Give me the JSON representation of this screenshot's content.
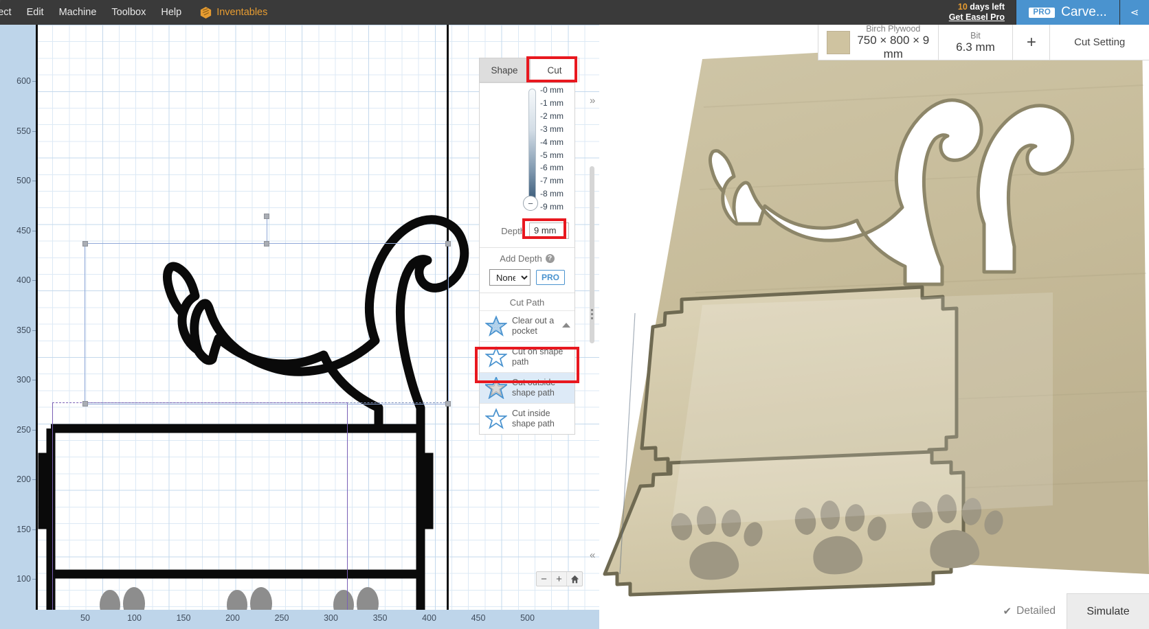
{
  "menubar": {
    "items": [
      "ject",
      "Edit",
      "Machine",
      "Toolbox",
      "Help"
    ],
    "brand": "Inventables",
    "trial_days": "10",
    "trial_text": " days left",
    "trial_link": "Get Easel Pro",
    "pro_chip": "PRO",
    "carve_label": "Carve...",
    "share_glyph": "⋖"
  },
  "canvas": {
    "y_ticks": [
      "600",
      "550",
      "500",
      "450",
      "400",
      "350",
      "300",
      "250",
      "200",
      "150",
      "100"
    ],
    "x_ticks": [
      "50",
      "100",
      "150",
      "200",
      "250",
      "300",
      "350",
      "400",
      "450",
      "500"
    ],
    "zoom_out": "−",
    "zoom_in": "+",
    "home": "home-icon"
  },
  "cut_panel": {
    "tab_shape": "Shape",
    "tab_cut": "Cut",
    "slider_labels": [
      "-0 mm",
      "-1 mm",
      "-2 mm",
      "-3 mm",
      "-4 mm",
      "-5 mm",
      "-6 mm",
      "-7 mm",
      "-8 mm",
      "-9 mm"
    ],
    "knob_glyph": "−",
    "depth_label": "Depth",
    "depth_value": "9 mm",
    "add_depth_label": "Add Depth",
    "help_glyph": "?",
    "add_depth_value": "None",
    "add_depth_options": [
      "None"
    ],
    "pro_badge": "PRO",
    "cut_path_title": "Cut Path",
    "cut_path_options": [
      {
        "label": "Clear out a pocket",
        "icon": "star-filled-icon",
        "selected": false
      },
      {
        "label": "Cut on shape path",
        "icon": "star-outline-icon",
        "selected": false
      },
      {
        "label": "Cut outside shape path",
        "icon": "star-outside-icon",
        "selected": true
      },
      {
        "label": "Cut inside shape path",
        "icon": "star-inside-icon",
        "selected": false
      }
    ]
  },
  "preview": {
    "material_name": "Birch Plywood",
    "material_size": "750 × 800 × 9 mm",
    "bit_label": "Bit",
    "bit_size": "6.3 mm",
    "add_material": "+",
    "cut_settings": "Cut Setting",
    "detailed_label": "Detailed",
    "detailed_check": "✔",
    "simulate_label": "Simulate"
  },
  "colors": {
    "accent_blue": "#4a93cf",
    "annotation_red": "#e8181f",
    "menubar_dark": "#3a3a3a",
    "brand_orange": "#e79c31",
    "wood": "#cfc3a0",
    "ruler_blue": "#bed5ea"
  }
}
